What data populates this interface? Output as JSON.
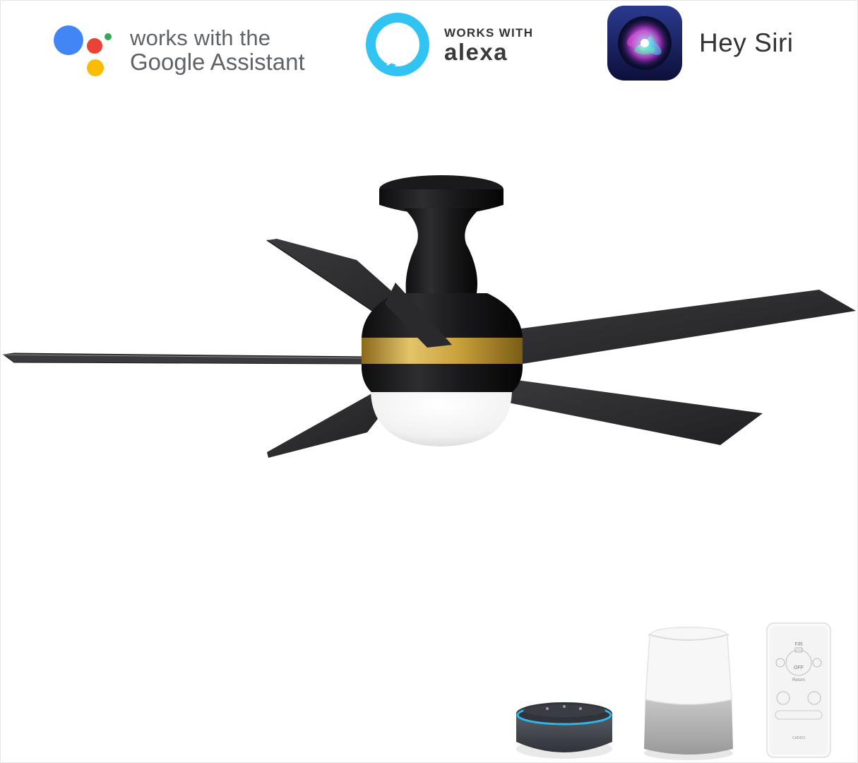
{
  "badges": {
    "google": {
      "line1": "works with the",
      "line2": "Google Assistant",
      "colors": {
        "blue": "#4285F4",
        "red": "#EA4335",
        "yellow": "#FBBC05",
        "green": "#34A853"
      }
    },
    "alexa": {
      "line1": "WORKS WITH",
      "line2": "alexa",
      "color": "#31C4F3"
    },
    "siri": {
      "label": "Hey Siri"
    }
  },
  "product": {
    "icons": [
      "ceiling-fan-icon",
      "smart-speaker-icon",
      "smart-display-speaker-icon",
      "remote-control-icon"
    ],
    "colors": {
      "body": "#1b1b1d",
      "accent_ring": "#c9a13b",
      "globe": "#f5f5f5",
      "blade": "#2a2a2c"
    }
  },
  "remote": {
    "fr_label": "F/R",
    "off_label": "OFF",
    "return_label": "Return",
    "brand": "CARRO"
  }
}
